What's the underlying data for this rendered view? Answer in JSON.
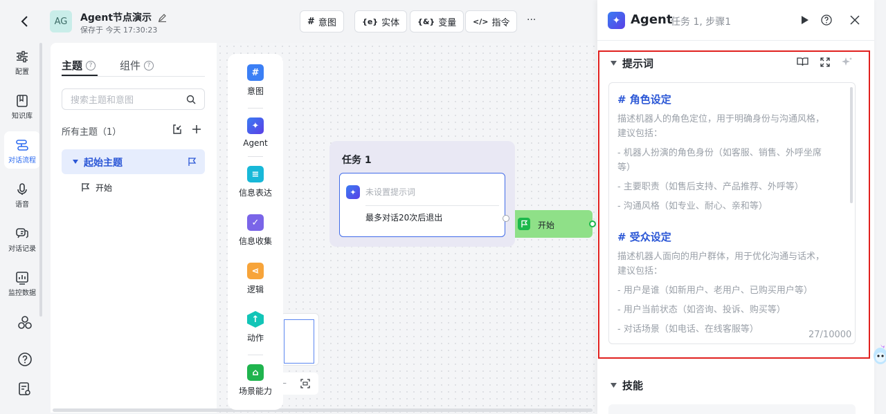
{
  "nav": {
    "items": [
      {
        "label": "配置",
        "icon": "sliders-icon"
      },
      {
        "label": "知识库",
        "icon": "book-icon"
      },
      {
        "label": "对话流程",
        "icon": "flow-icon"
      },
      {
        "label": "语音",
        "icon": "microphone-icon"
      },
      {
        "label": "对话记录",
        "icon": "chat-icon"
      },
      {
        "label": "监控数据",
        "icon": "chart-icon"
      }
    ]
  },
  "header": {
    "avatar": "AG",
    "title": "Agent节点演示",
    "save_info": "保存于 今天 17:30:23",
    "tools": [
      {
        "icon": "#",
        "label": "意图"
      },
      {
        "icon": "{e}",
        "label": "实体"
      },
      {
        "icon": "{&}",
        "label": "变量"
      },
      {
        "icon": "</>",
        "label": "指令"
      }
    ],
    "more": "···"
  },
  "topics": {
    "tabs": [
      "主题",
      "组件"
    ],
    "search_placeholder": "搜索主题和意图",
    "all_label": "所有主题（1）",
    "selected": "起始主题",
    "child": "开始"
  },
  "palette": {
    "items": [
      {
        "label": "意图",
        "icon": "#",
        "color": "#3b7ff5"
      },
      {
        "label": "Agent",
        "icon": "✦",
        "color": "#3f56e8"
      },
      {
        "label": "信息表达",
        "icon": "≡",
        "color": "#18b8d8"
      },
      {
        "label": "信息收集",
        "icon": "✓",
        "color": "#7a65e8"
      },
      {
        "label": "逻辑",
        "icon": "⋖",
        "color": "#f7a43a"
      },
      {
        "label": "动作",
        "icon": "↑",
        "color": "#12c5b7"
      },
      {
        "label": "场景能力",
        "icon": "⌂",
        "color": "#1fb44e"
      }
    ]
  },
  "task_node": {
    "title": "任务 1",
    "placeholder": "未设置提示词",
    "desc": "最多对话20次后退出"
  },
  "start_node": {
    "label": "开始"
  },
  "panel": {
    "title": "Agent",
    "subtitle": "任务 1, 步骤1",
    "prompt_section": "提示词",
    "skills_section": "技能",
    "counter": "27/10000",
    "prompt_lines": [
      {
        "type": "h",
        "text": "# 角色设定"
      },
      {
        "type": "p",
        "text": "描述机器人的角色定位，用于明确身份与沟通风格，建议包括："
      },
      {
        "type": "p",
        "text": "- 机器人扮演的角色身份（如客服、销售、外呼坐席等）"
      },
      {
        "type": "p",
        "text": "- 主要职责（如售后支持、产品推荐、外呼等）"
      },
      {
        "type": "p",
        "text": "- 沟通风格（如专业、耐心、亲和等）"
      },
      {
        "type": "h",
        "text": "# 受众设定"
      },
      {
        "type": "p",
        "text": "描述机器人面向的用户群体，用于优化沟通与话术，建议包括："
      },
      {
        "type": "p",
        "text": "- 用户是谁（如新用户、老用户、已购买用户等）"
      },
      {
        "type": "p",
        "text": "- 用户当前状态（如咨询、投诉、购买等）"
      },
      {
        "type": "p",
        "text": "- 对话场景（如电话、在线客服等）"
      }
    ]
  }
}
